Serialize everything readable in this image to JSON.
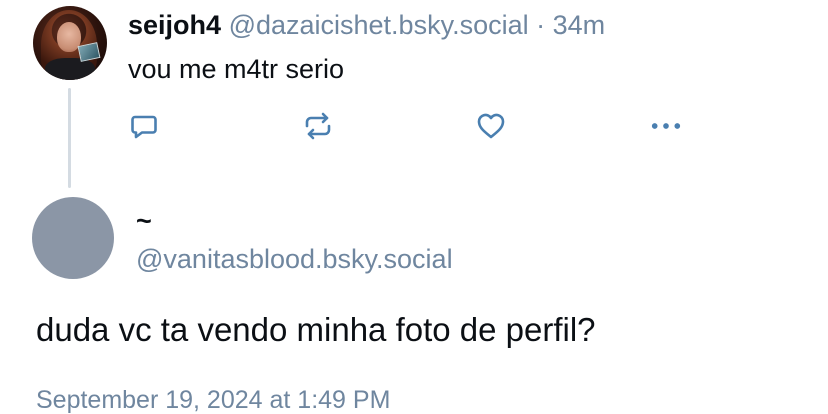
{
  "parent_post": {
    "display_name": "seijoh4",
    "handle": "@dazaicishet.bsky.social",
    "separator": "·",
    "time_ago": "34m",
    "text": "vou me m4tr serio",
    "actions": {
      "reply_icon": "reply-icon",
      "repost_icon": "repost-icon",
      "like_icon": "heart-icon",
      "more_icon": "more-icon"
    }
  },
  "main_post": {
    "display_name": "~",
    "handle": "@vanitasblood.bsky.social",
    "text": "duda vc ta vendo minha foto de perfil?",
    "timestamp": "September 19, 2024 at 1:49 PM"
  },
  "colors": {
    "text": "#0b0f14",
    "muted": "#6f869f",
    "icon": "#4a7fb0",
    "thread_line": "#d4dbe2",
    "default_avatar": "#8b96a6"
  }
}
